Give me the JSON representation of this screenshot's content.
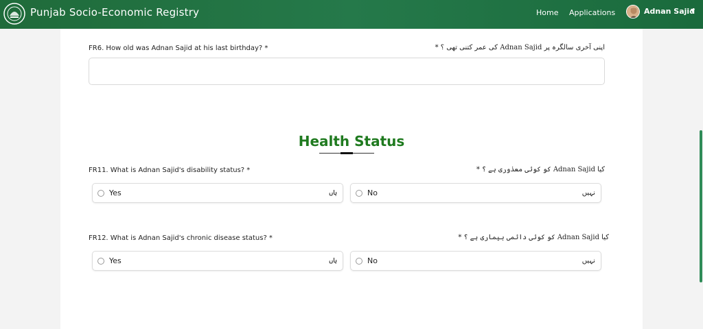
{
  "header": {
    "brand": "Punjab Socio-Economic Registry",
    "nav": {
      "home": "Home",
      "applications": "Applications"
    },
    "user": "Adnan Sajid"
  },
  "fr6": {
    "label": "FR6. How old was Adnan Sajid at his last birthday? *",
    "urdu": "اپنی آخری سالگرہ پر Adnan Sajid کی عمر کتنی تھی ؟ *",
    "value": ""
  },
  "section": {
    "title": "Health Status"
  },
  "fr11": {
    "label": "FR11. What is Adnan Sajid's disability status? *",
    "urdu": "کیا Adnan Sajid کو کوئی معذوری ہے ؟ *",
    "options": [
      {
        "en": "Yes",
        "ur": "ہاں"
      },
      {
        "en": "No",
        "ur": "نہیں"
      }
    ]
  },
  "fr12": {
    "label": "FR12. What is Adnan Sajid's chronic disease status? *",
    "urdu": "کیا Adnan Sajid کو کوئی دائمی بیماری ہے ؟ *",
    "options": [
      {
        "en": "Yes",
        "ur": "ہاں"
      },
      {
        "en": "No",
        "ur": "نہیں"
      }
    ]
  },
  "colors": {
    "brand_green": "#1f6b3a",
    "title_green": "#1f7a1f"
  },
  "icons": {
    "logo": "punjab-emblem-icon",
    "caret": "chevron-down-icon",
    "radio": "radio-icon"
  }
}
